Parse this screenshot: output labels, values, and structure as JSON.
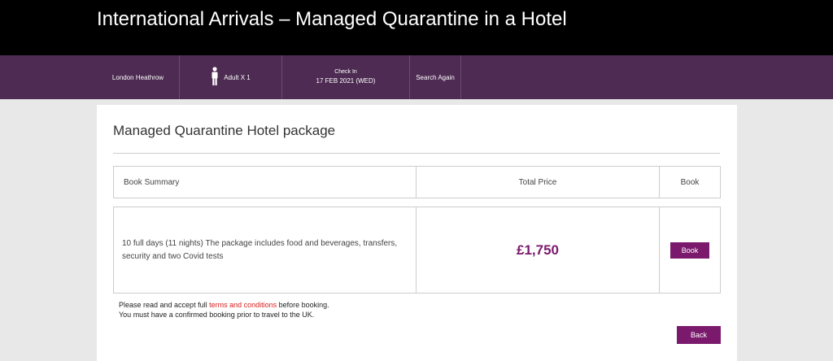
{
  "header": {
    "title": "International Arrivals – Managed Quarantine in a Hotel"
  },
  "search": {
    "location": "London Heathrow",
    "guests": "Adult X 1",
    "checkin_label": "Check In",
    "checkin_date": "17 FEB 2021 (WED)",
    "search_again": "Search Again"
  },
  "package": {
    "title": "Managed Quarantine Hotel package",
    "headers": {
      "summary": "Book Summary",
      "price": "Total Price",
      "book": "Book"
    },
    "description": "10 full days (11 nights) The package includes food and beverages, transfers, security and two Covid tests",
    "price": "£1,750",
    "book_label": "Book"
  },
  "notes": {
    "line1_pre": "Please read and accept full ",
    "terms_link": "terms and conditions",
    "line1_post": " before booking.",
    "line2": "You must have a confirmed booking prior to travel to the UK."
  },
  "back_label": "Back",
  "colors": {
    "accent": "#7b1a6c",
    "bar": "#4d2b52",
    "link": "#d81e1e"
  },
  "icons": {
    "guest": "person-icon"
  }
}
